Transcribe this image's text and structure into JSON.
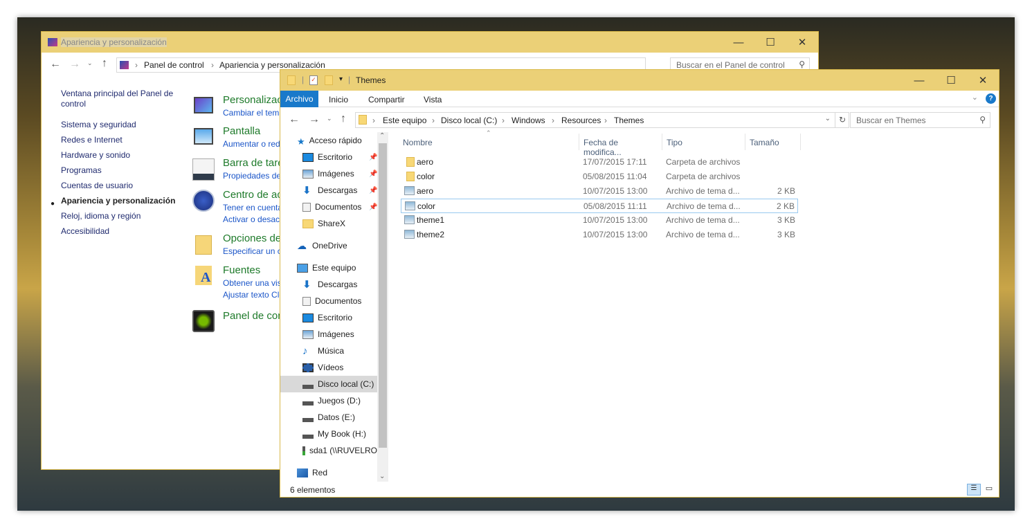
{
  "control_panel": {
    "title": "Apariencia y personalización",
    "breadcrumb": [
      "Panel de control",
      "Apariencia y personalización"
    ],
    "search_placeholder": "Buscar en el Panel de control",
    "sidebar": [
      "Ventana principal del Panel de control",
      "Sistema y seguridad",
      "Redes e Internet",
      "Hardware y sonido",
      "Programas",
      "Cuentas de usuario",
      "Apariencia y personalización",
      "Reloj, idioma y región",
      "Accesibilidad"
    ],
    "categories": [
      {
        "title": "Personalización",
        "links": [
          "Cambiar el tema"
        ],
        "icon": "monitor-personalize-icon"
      },
      {
        "title": "Pantalla",
        "links": [
          "Aumentar o reducir"
        ],
        "icon": "monitor-icon"
      },
      {
        "title": "Barra de tareas",
        "links": [
          "Propiedades de"
        ],
        "icon": "taskbar-icon"
      },
      {
        "title": "Centro de accesibilidad",
        "links": [
          "Tener en cuenta",
          "Activar o desactivar"
        ],
        "icon": "ease-of-access-icon"
      },
      {
        "title": "Opciones del Explorador",
        "links": [
          "Especificar un clic"
        ],
        "icon": "folder-options-icon"
      },
      {
        "title": "Fuentes",
        "links": [
          "Obtener una vista",
          "Ajustar texto ClearType"
        ],
        "icon": "fonts-icon"
      },
      {
        "title": "Panel de control de NVIDIA",
        "links": [],
        "icon": "nvidia-icon"
      }
    ]
  },
  "explorer": {
    "title": "Themes",
    "ribbon_tabs": [
      "Archivo",
      "Inicio",
      "Compartir",
      "Vista"
    ],
    "breadcrumb": [
      "Este equipo",
      "Disco local (C:)",
      "Windows",
      "Resources",
      "Themes"
    ],
    "search_placeholder": "Buscar en Themes",
    "nav": {
      "quick_access": "Acceso rápido",
      "quick_items": [
        "Escritorio",
        "Imágenes",
        "Descargas",
        "Documentos",
        "ShareX"
      ],
      "onedrive": "OneDrive",
      "this_pc": "Este equipo",
      "pc_items": [
        "Descargas",
        "Documentos",
        "Escritorio",
        "Imágenes",
        "Música",
        "Vídeos",
        "Disco local (C:)",
        "Juegos (D:)",
        "Datos (E:)",
        "My Book (H:)",
        "sda1 (\\\\RUVELRO"
      ],
      "network": "Red"
    },
    "columns": [
      "Nombre",
      "Fecha de modifica...",
      "Tipo",
      "Tamaño"
    ],
    "files": [
      {
        "name": "aero",
        "date": "17/07/2015 17:11",
        "type": "Carpeta de archivos",
        "size": "",
        "kind": "folder"
      },
      {
        "name": "color",
        "date": "05/08/2015 11:04",
        "type": "Carpeta de archivos",
        "size": "",
        "kind": "folder"
      },
      {
        "name": "aero",
        "date": "10/07/2015 13:00",
        "type": "Archivo de tema d...",
        "size": "2 KB",
        "kind": "theme"
      },
      {
        "name": "color",
        "date": "05/08/2015 11:11",
        "type": "Archivo de tema d...",
        "size": "2 KB",
        "kind": "theme"
      },
      {
        "name": "theme1",
        "date": "10/07/2015 13:00",
        "type": "Archivo de tema d...",
        "size": "3 KB",
        "kind": "theme"
      },
      {
        "name": "theme2",
        "date": "10/07/2015 13:00",
        "type": "Archivo de tema d...",
        "size": "3 KB",
        "kind": "theme"
      }
    ],
    "status": "6 elementos"
  },
  "colors": {
    "titlebar": "#ebd077",
    "accent": "#1979ca",
    "link": "#1a55c8",
    "heading": "#1e7a2a"
  }
}
